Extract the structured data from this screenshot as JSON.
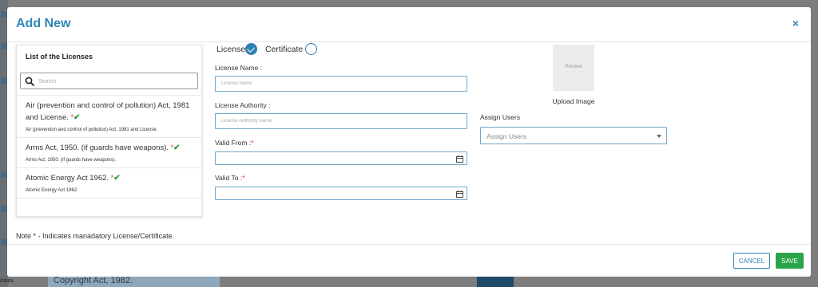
{
  "background": {
    "inbox_label": "Inbox",
    "card_text": "Copyright Act, 1982."
  },
  "modal": {
    "title": "Add New",
    "close_symbol": "×"
  },
  "licenses_panel": {
    "title": "List of the Licenses",
    "search_placeholder": "Search",
    "items": [
      {
        "title": "Air (prevention and control of pollution) Act, 1981 and License.",
        "mandatory": true,
        "checked": true,
        "subtitle": "Air (prevention and control of pollution) Act, 1981 and License."
      },
      {
        "title": "Arms Act, 1950. (if guards have weapons).",
        "mandatory": true,
        "checked": true,
        "subtitle": "Arms Act, 1950. (if guards have weapons)."
      },
      {
        "title": "Atomic Energy Act 1962.",
        "mandatory": true,
        "checked": true,
        "subtitle": "Atomic Energy Act 1962."
      }
    ]
  },
  "note": "Note * - Indicates manadatory License/Certificate.",
  "type_selector": {
    "license_label": "License",
    "certificate_label": "Certificate",
    "selected": "License"
  },
  "form": {
    "license_name_label": "License Name :",
    "license_name_placeholder": "License Name",
    "license_authority_label": "License Authority :",
    "license_authority_placeholder": "License Authority Name",
    "valid_from_label": "Valid From :",
    "valid_to_label": "Valid To :",
    "required_marker": "*"
  },
  "image": {
    "preview_text": "Preview",
    "upload_label": "Upload Image"
  },
  "assign_users": {
    "label": "Assign Users",
    "placeholder": "Assign Users"
  },
  "footer": {
    "cancel_label": "CANCEL",
    "save_label": "SAVE"
  },
  "colors": {
    "accent": "#2f86b8",
    "save": "#2aa54a",
    "required": "#e0302f",
    "check": "#2e9c3a"
  }
}
